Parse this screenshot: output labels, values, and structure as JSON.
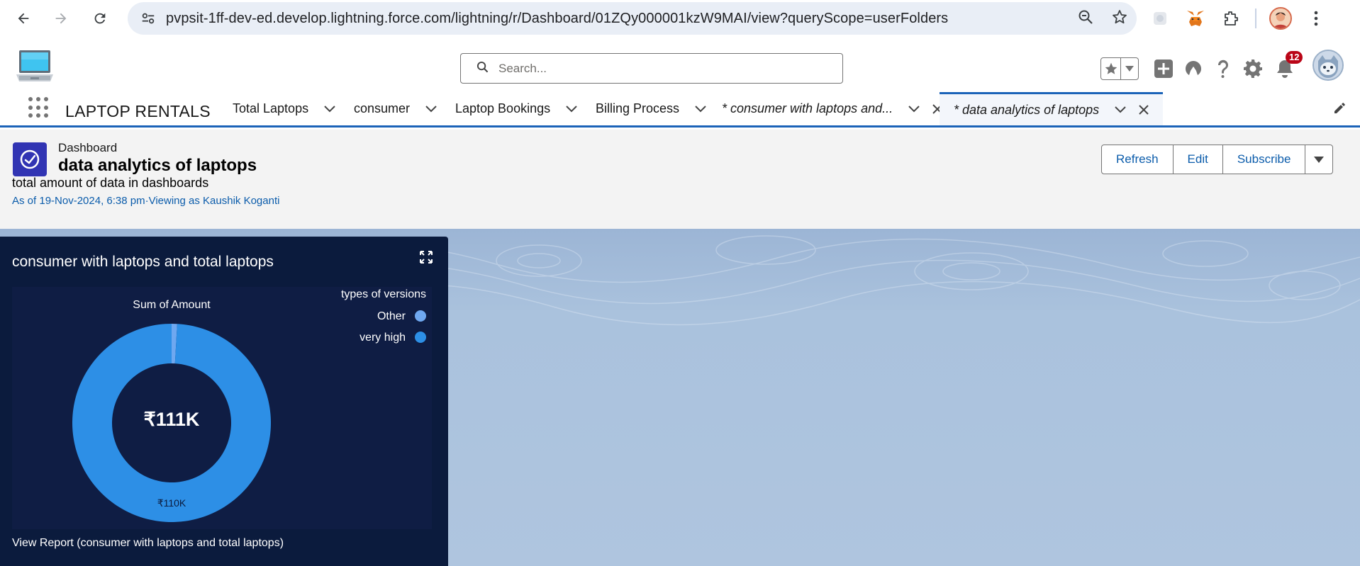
{
  "browser": {
    "url": "pvpsit-1ff-dev-ed.develop.lightning.force.com/lightning/r/Dashboard/01ZQy000001kzW9MAI/view?queryScope=userFolders"
  },
  "header": {
    "search_placeholder": "Search...",
    "notification_count": "12"
  },
  "nav": {
    "app_name": "LAPTOP RENTALS",
    "tabs": [
      {
        "label": "Total Laptops"
      },
      {
        "label": "consumer"
      },
      {
        "label": "Laptop Bookings"
      },
      {
        "label": "Billing Process"
      },
      {
        "label": "* consumer with laptops and..."
      },
      {
        "label": "* data analytics of laptops"
      }
    ]
  },
  "dashboard": {
    "type_label": "Dashboard",
    "title": "data analytics of laptops",
    "description": "total amount of data in dashboards",
    "meta": "As of 19-Nov-2024, 6:38 pm·Viewing as Kaushik Koganti",
    "buttons": {
      "refresh": "Refresh",
      "edit": "Edit",
      "subscribe": "Subscribe"
    }
  },
  "widget": {
    "title": "consumer with laptops and total laptops",
    "view_report": "View Report (consumer with laptops and total laptops)"
  },
  "chart_data": {
    "type": "donut",
    "title": "Sum of Amount",
    "center_label": "₹111K",
    "legend_title": "types of versions",
    "legend_position": "top-right",
    "categories": [
      "Other",
      "very high"
    ],
    "values": [
      1,
      110
    ],
    "value_unit": "K (₹)",
    "data_labels": [
      "",
      "₹110K"
    ],
    "colors": [
      "#6fa8f0",
      "#2d8fe6"
    ]
  },
  "colors": {
    "brand_blue": "#1b63b8",
    "link_blue": "#0b5cab",
    "widget_bg": "#0b1b3d",
    "dashboard_icon": "#3134b3"
  }
}
